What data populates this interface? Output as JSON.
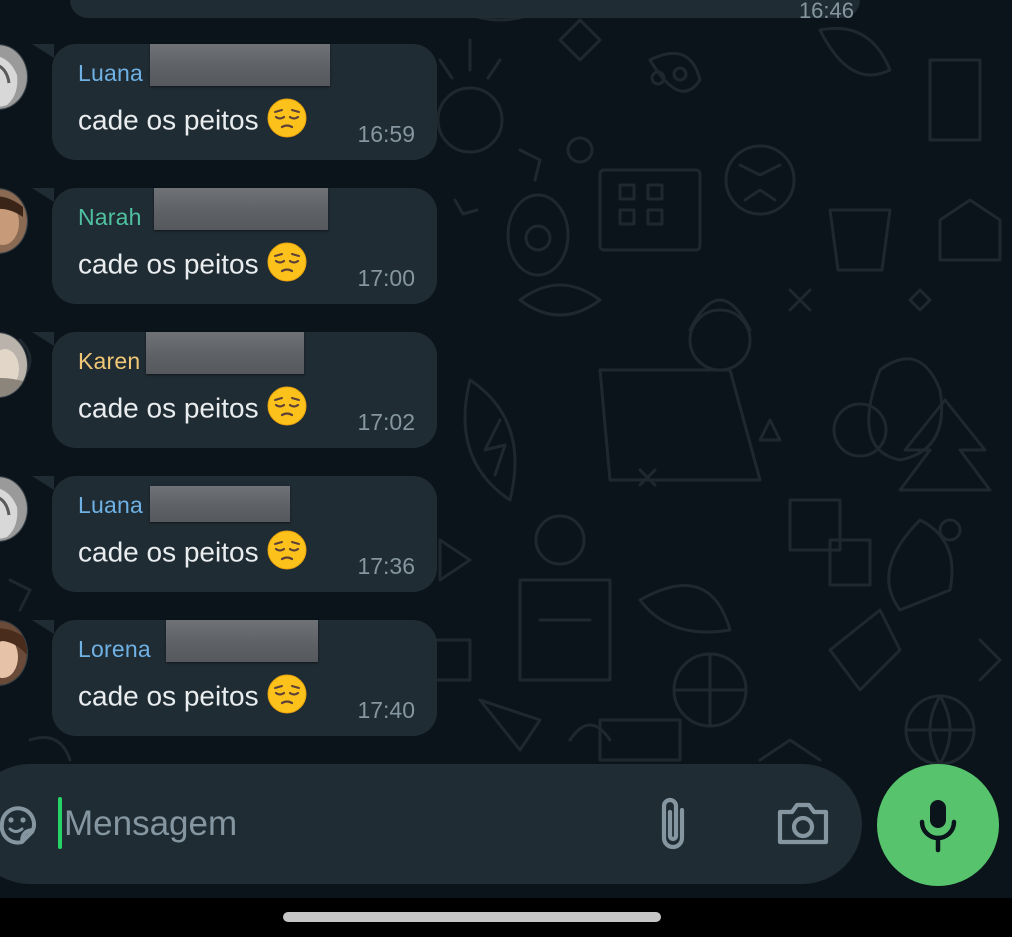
{
  "chat": {
    "top_partial_time": "16:46",
    "messages": [
      {
        "sender": "Luana",
        "sender_color": "#6fb1e4",
        "text": "cade os peitos",
        "emoji": "pensive-face",
        "time": "16:59"
      },
      {
        "sender": "Narah",
        "sender_color": "#4fc1a1",
        "text": "cade os peitos",
        "emoji": "pensive-face",
        "time": "17:00"
      },
      {
        "sender": "Karen",
        "sender_color": "#f0c776",
        "text": "cade os peitos",
        "emoji": "pensive-face",
        "time": "17:02"
      },
      {
        "sender": "Luana",
        "sender_color": "#6fb1e4",
        "text": "cade os peitos",
        "emoji": "pensive-face",
        "time": "17:36"
      },
      {
        "sender": "Lorena",
        "sender_color": "#6fb1e4",
        "text": "cade os peitos",
        "emoji": "pensive-face",
        "time": "17:40"
      }
    ]
  },
  "composer": {
    "placeholder": "Mensagem",
    "icons": [
      "sticker-icon",
      "attach-icon",
      "camera-icon",
      "mic-icon"
    ],
    "accent": "#57c46d"
  },
  "colors": {
    "background": "#0b141a",
    "bubble": "#202c33",
    "timestamp": "#8696a0"
  }
}
